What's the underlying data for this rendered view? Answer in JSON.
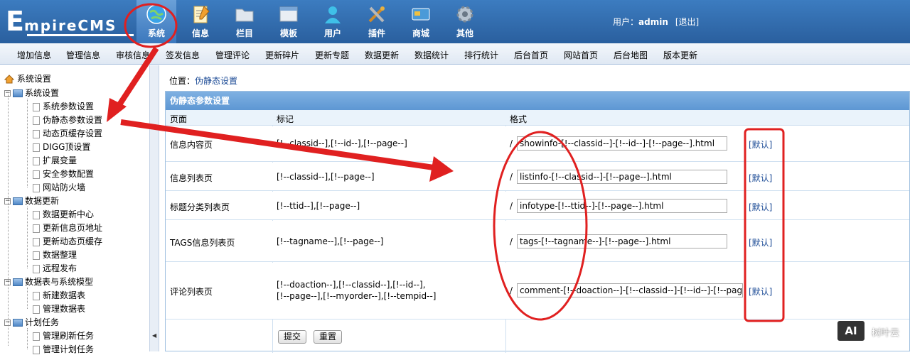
{
  "header": {
    "logo_first": "E",
    "logo_rest": "mpireCMS",
    "nav": [
      {
        "label": "系统",
        "icon": "globe-icon"
      },
      {
        "label": "信息",
        "icon": "notepad-icon"
      },
      {
        "label": "栏目",
        "icon": "folder-icon"
      },
      {
        "label": "模板",
        "icon": "window-icon"
      },
      {
        "label": "用户",
        "icon": "user-icon"
      },
      {
        "label": "插件",
        "icon": "tools-icon"
      },
      {
        "label": "商城",
        "icon": "card-icon"
      },
      {
        "label": "其他",
        "icon": "gear-icon"
      }
    ],
    "user_label": "用户：",
    "user_name": "admin",
    "logout": "[退出]",
    "colors": {
      "bar": "#2f6cb0",
      "active": "#5a93d0"
    }
  },
  "menu": [
    "增加信息",
    "管理信息",
    "审核信息",
    "签发信息",
    "管理评论",
    "更新碎片",
    "更新专题",
    "数据更新",
    "数据统计",
    "排行统计",
    "后台首页",
    "网站首页",
    "后台地图",
    "版本更新"
  ],
  "sidebar": {
    "root": "系统设置",
    "groups": [
      {
        "label": "系统设置",
        "items": [
          "系统参数设置",
          "伪静态参数设置",
          "动态页缓存设置",
          "DIGG顶设置",
          "扩展变量",
          "安全参数配置",
          "网站防火墙"
        ]
      },
      {
        "label": "数据更新",
        "items": [
          "数据更新中心",
          "更新信息页地址",
          "更新动态页缓存",
          "数据整理",
          "远程发布"
        ]
      },
      {
        "label": "数据表与系统模型",
        "items": [
          "新建数据表",
          "管理数据表"
        ]
      },
      {
        "label": "计划任务",
        "items": [
          "管理刷新任务",
          "管理计划任务"
        ]
      }
    ]
  },
  "main": {
    "crumb_label": "位置：",
    "crumb_link": "伪静态设置",
    "panel_title": "伪静态参数设置",
    "col_page": "页面",
    "col_mark": "标记",
    "col_format": "格式",
    "rows": [
      {
        "page": "信息内容页",
        "mark": "[!--classid--],[!--id--],[!--page--]",
        "slash": "/",
        "format": "showinfo-[!--classid--]-[!--id--]-[!--page--].html",
        "default": "[默认]"
      },
      {
        "page": "信息列表页",
        "mark": "[!--classid--],[!--page--]",
        "slash": "/",
        "format": "listinfo-[!--classid--]-[!--page--].html",
        "default": "[默认]"
      },
      {
        "page": "标题分类列表页",
        "mark": "[!--ttid--],[!--page--]",
        "slash": "/",
        "format": "infotype-[!--ttid--]-[!--page--].html",
        "default": "[默认]"
      },
      {
        "page": "TAGS信息列表页",
        "mark": "[!--tagname--],[!--page--]",
        "slash": "/",
        "format": "tags-[!--tagname--]-[!--page--].html",
        "default": "[默认]"
      },
      {
        "page": "评论列表页",
        "mark": "[!--doaction--],[!--classid--],[!--id--],",
        "mark2": "[!--page--],[!--myorder--],[!--tempid--]",
        "slash": "/",
        "format": "comment-[!--doaction--]-[!--classid--]-[!--id--]-[!--page--",
        "default": "[默认]"
      }
    ],
    "submit": "提交",
    "reset": "重置"
  },
  "watermark": {
    "badge": "AI",
    "text": "树叶云"
  },
  "annotation_color": "#e02020"
}
